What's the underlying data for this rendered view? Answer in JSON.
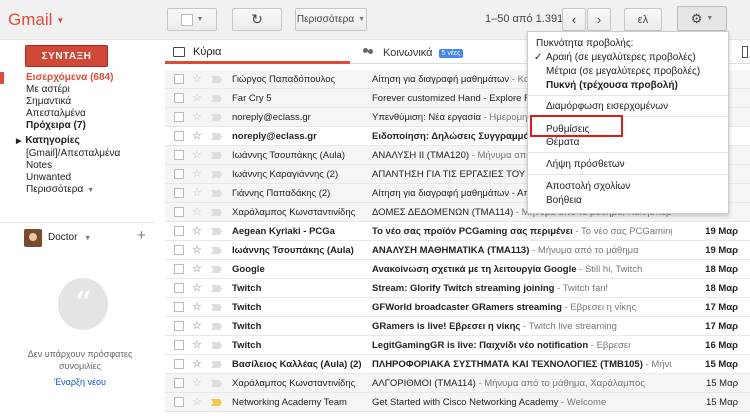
{
  "app": {
    "logo": "Gmail"
  },
  "toolbar": {
    "more_label": "Περισσότερα",
    "range": "1–50 από 1.391",
    "lang": "ελ"
  },
  "nav": {
    "compose": "ΣΥΝΤΑΞΗ",
    "items": [
      {
        "label": "Εισερχόμενα (684)"
      },
      {
        "label": "Με αστέρι"
      },
      {
        "label": "Σημαντικά"
      },
      {
        "label": "Απεσταλμένα"
      },
      {
        "label": "Πρόχειρα (7)"
      }
    ],
    "categories_label": "Κατηγορίες",
    "extra": [
      {
        "label": "[Gmail]/Απεσταλμένα"
      },
      {
        "label": "Notes"
      },
      {
        "label": "Unwanted"
      },
      {
        "label": "Περισσότερα"
      }
    ]
  },
  "hangout": {
    "name": "Doctor",
    "empty_text": "Δεν υπάρχουν πρόσφατες συνομιλίες",
    "start_link": "Έναρξη νέου"
  },
  "tabs": [
    {
      "label": "Κύρια"
    },
    {
      "label": "Κοινωνικά",
      "badge": "5 νέες"
    }
  ],
  "emails": [
    {
      "sender": "Γιώργος Παπαδόπουλος",
      "subject": "Αίτηση για διαγραφή μαθημάτων",
      "snippet": " - Καλησπέρα σας",
      "date": "",
      "unread": false,
      "important": false
    },
    {
      "sender": "Far Cry 5",
      "subject": "Forever customized Hand - Explore Far Cry 5",
      "snippet": "",
      "date": "",
      "unread": false,
      "important": false
    },
    {
      "sender": "noreply@eclass.gr",
      "subject": "Υπενθύμιση: Νέα εργασία",
      "snippet": " - Ημερομηνία",
      "date": "",
      "unread": false,
      "important": false
    },
    {
      "sender": "noreply@eclass.gr",
      "subject": "Ειδοποίηση: Δηλώσεις Συγγραμμάτων",
      "snippet": "",
      "date": "",
      "unread": true,
      "important": false
    },
    {
      "sender": "Ιωάννης Τσουπάκης (Aula)",
      "subject": "ΑΝΑΛΥΣΗ ΙΙ (ΤΜΑ120)",
      "snippet": " - Μήνυμα από το μάθημα",
      "date": "",
      "unread": false,
      "important": false
    },
    {
      "sender": "Ιωάννης Καραγιάννης (2)",
      "subject": "ΑΠΑΝΤΗΣΗ ΓΙΑ ΤΙΣ ΕΡΓΑΣΙΕΣ ΤΟΥ ΜΑΘΗΜΑΤΟΣ",
      "snippet": "",
      "date": "",
      "unread": false,
      "important": false
    },
    {
      "sender": "Γιάννης Παπαδάκης (2)",
      "subject": "Αίτηση για διαγραφή μαθημάτων - Απάντηση",
      "snippet": "",
      "date": "",
      "unread": false,
      "important": false
    },
    {
      "sender": "Χαράλαμπος Κωνσταντινίδης",
      "subject": "ΔΟΜΕΣ ΔΕΔΟΜΕΝΩΝ (ΤΜΑ114)",
      "snippet": " - Μήνυμα από το μάθημα, Καλησπέρα",
      "date": "",
      "unread": false,
      "important": false
    },
    {
      "sender": "Aegean Kyriaki - PCGa",
      "subject": "Το νέο σας προϊόν PCGaming σας περιμένει",
      "snippet": " - Το νέο σας PCGaming",
      "date": "19 Μαρ",
      "unread": true,
      "important": false
    },
    {
      "sender": "Ιωάννης Τσουπάκης (Aula)",
      "subject": "ΑΝΑΛΥΣΗ ΜΑΘΗΜΑΤΙΚΑ (ΤΜΑ113)",
      "snippet": " - Μήνυμα από το μάθημα",
      "date": "19 Μαρ",
      "unread": true,
      "important": false
    },
    {
      "sender": "Google",
      "subject": "Ανακοίνωση σχετικά με τη λειτουργία Google",
      "snippet": " - Still hi, Twitch",
      "date": "18 Μαρ",
      "unread": true,
      "important": false
    },
    {
      "sender": "Twitch",
      "subject": "Stream: Glorify Twitch streaming joining",
      "snippet": " - Twitch fan!",
      "date": "18 Μαρ",
      "unread": true,
      "important": false
    },
    {
      "sender": "Twitch",
      "subject": "GFWorld broadcaster GRamers streaming",
      "snippet": " - Εβρεσει η νίκης",
      "date": "17 Μαρ",
      "unread": true,
      "important": false
    },
    {
      "sender": "Twitch",
      "subject": "GRamers is live! Εβρεσει η νίκης",
      "snippet": " - Twitch live streaming",
      "date": "17 Μαρ",
      "unread": true,
      "important": false
    },
    {
      "sender": "Twitch",
      "subject": "LegitGamingGR is live: Παιχνίδι νέο notification",
      "snippet": " - Εβρεσει",
      "date": "16 Μαρ",
      "unread": true,
      "important": false
    },
    {
      "sender": "Βασίλειος Καλλέας (Aula) (2)",
      "subject": "ΠΛΗΡΟΦΟΡΙΑΚΑ ΣΥΣΤΗΜΑΤΑ ΚΑΙ ΤΕΧΝΟΛΟΓΙΕΣ (ΤΜΒ105)",
      "snippet": " - Μήνυμα",
      "date": "15 Μαρ",
      "unread": true,
      "important": false
    },
    {
      "sender": "Χαράλαμπος Κωνσταντινίδης",
      "subject": "ΑΛΓΟΡΙΘΜΟΙ (ΤΜΑ114)",
      "snippet": " - Μήνυμα από το μάθημα, Χαράλαμπος",
      "date": "15 Μαρ",
      "unread": false,
      "important": false
    },
    {
      "sender": "Networking Academy Team",
      "subject": "Get Started with Cisco Networking Academy",
      "snippet": " - Welcome",
      "date": "15 Μαρ",
      "unread": false,
      "important": true
    }
  ],
  "menu": {
    "density_header": "Πυκνότητα προβολής:",
    "density": [
      {
        "label": "Αραιή (σε μεγαλύτερες προβολές)",
        "checked": true,
        "bold": false
      },
      {
        "label": "Μέτρια (σε μεγαλύτερες προβολές)",
        "checked": false,
        "bold": false
      },
      {
        "label": "Πυκνή (τρέχουσα προβολή)",
        "checked": false,
        "bold": true
      }
    ],
    "configure_inbox": "Διαμόρφωση εισερχομένων",
    "settings": "Ρυθμίσεις",
    "themes": "Θέματα",
    "get_addons": "Λήψη πρόσθετων",
    "send_feedback": "Αποστολή σχολίων",
    "help": "Βοήθεια"
  }
}
